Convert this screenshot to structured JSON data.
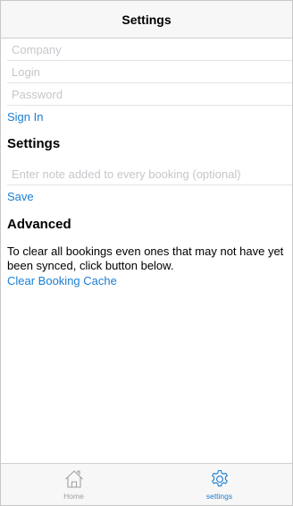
{
  "navbar": {
    "title": "Settings"
  },
  "login": {
    "company_placeholder": "Company",
    "login_placeholder": "Login",
    "password_placeholder": "Password",
    "sign_in_label": "Sign In"
  },
  "settings": {
    "title": "Settings",
    "note_placeholder": "Enter note added to every booking (optional)",
    "save_label": "Save"
  },
  "advanced": {
    "title": "Advanced",
    "description": "To clear all bookings even ones that may not have yet been synced, click button below.",
    "clear_label": "Clear Booking Cache"
  },
  "tabbar": {
    "items": [
      {
        "label": "Home",
        "icon": "home-icon",
        "active": false
      },
      {
        "label": "settings",
        "icon": "gear-icon",
        "active": true
      }
    ]
  },
  "colors": {
    "accent": "#1a7ed1",
    "placeholder": "#c7c7cc",
    "inactive_tab": "#a0a0a0"
  }
}
